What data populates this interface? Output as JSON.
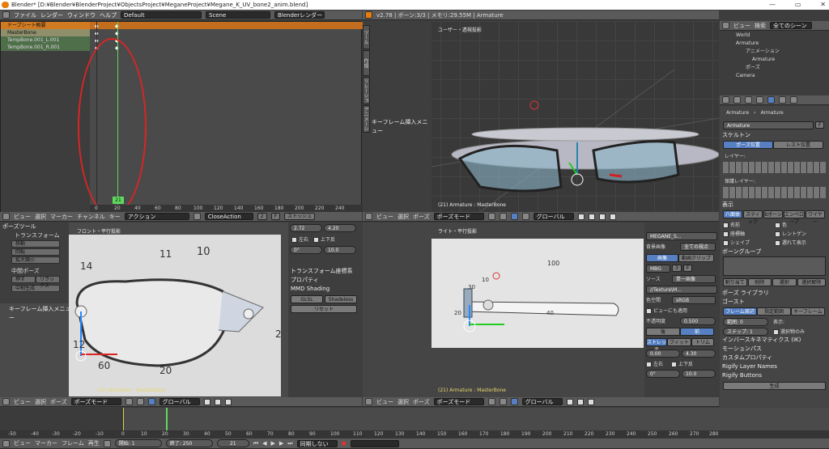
{
  "title_bar": {
    "text": "Blender* [D:¥Blender¥BlenderProject¥ObjectsProject¥MeganeProject¥Megane_K_UV_bone2_anim.blend]"
  },
  "top_menu": {
    "items": [
      "ファイル",
      "レンダー",
      "ウィンドウ",
      "ヘルプ"
    ],
    "layout": "Default",
    "scene": "Scene",
    "engine": "Blenderレンダー",
    "info": "v2.78 | ボーン:3/3 | メモリ:29.55M | Armature"
  },
  "dopesheet": {
    "channels": [
      "ドープシート概要",
      "MasterBone",
      "TempBone.001_L.001",
      "TempBone.001_R.001"
    ],
    "ruler": [
      "0",
      "20",
      "40",
      "60",
      "80",
      "100",
      "120",
      "140",
      "160",
      "180",
      "200",
      "220",
      "240"
    ],
    "current_frame": "21",
    "header": {
      "items": [
        "ビュー",
        "選択",
        "マーカー",
        "チャンネル",
        "キー"
      ],
      "mode": "アクション",
      "action": "CloseAction",
      "users": "2",
      "f": "F",
      "stash": "ストッシュ"
    }
  },
  "viewport_top": {
    "label": "ユーザー・透視投影",
    "status": "(21) Armature : MasterBone",
    "side_tabs": [
      "ツール",
      "作成",
      "リレーション",
      "アニメーション",
      "物理演算",
      "Grease Pencil"
    ],
    "panel_title": "キーフレーム挿入メニュー",
    "header": {
      "items": [
        "ビュー",
        "選択",
        "ポーズ"
      ],
      "mode": "ポーズモード",
      "orientation": "グローバル"
    }
  },
  "viewport_front": {
    "label": "フロント・平行投影",
    "status": "(21) Armature : MasterBone",
    "tool_title": "ポーズツール",
    "transform": "トランスフォーム",
    "tools": [
      "移動",
      "回転",
      "拡大縮小"
    ],
    "pose_title": "中間ポーズ",
    "pose_btns": [
      "押す",
      "リラックス"
    ],
    "breakdown": "中割生成",
    "key_panel": "キーフレーム挿入メニュー",
    "annotations": [
      "11",
      "10",
      "14",
      "12",
      "60",
      "20",
      "2"
    ],
    "header": {
      "items": [
        "ビュー",
        "選択",
        "ポーズ"
      ],
      "mode": "ポーズモード",
      "orientation": "グローバル"
    }
  },
  "front_props": {
    "vals": [
      "2.72",
      "4.20"
    ],
    "left_right": "左右",
    "up_down": "上下反",
    "v_deg": "0°",
    "v_ten": "10.0",
    "sections": [
      "トランスフォーム座標系",
      "プロパティ",
      "MMD Shading"
    ],
    "glsl": "GLSL",
    "shadeless": "Shadeless",
    "reset": "リセット"
  },
  "viewport_right": {
    "label": "ライト・平行投影",
    "status": "(21) Armature : MasterBone",
    "annotations": [
      "100",
      "10",
      "30",
      "20",
      "40"
    ],
    "header": {
      "items": [
        "ビュー",
        "選択",
        "ポーズ"
      ],
      "mode": "ポーズモード",
      "orientation": "グローバル"
    }
  },
  "image_panel": {
    "name": "MEGANE_S...",
    "source_label": "背景画像",
    "show_all": "全ての視点",
    "image": "画像",
    "movieclip": "動画クリップ",
    "img_name": "MBG",
    "users": "3",
    "f": "F",
    "source": "ソース",
    "single": "単一画像",
    "path": "//Texture\\M...",
    "colorspace_label": "色空間",
    "colorspace": "sRGB",
    "view_as_render": "ビューにも適用",
    "opacity_label": "不透明度",
    "opacity": "0.500",
    "back": "後",
    "front": "前",
    "stretch": "ストレッチ",
    "fit": "フィット",
    "crop": "トリム",
    "x": "0.00",
    "y": "4.30",
    "flip_x": "左右",
    "flip_y": "上下反",
    "rot": "0°",
    "size": "10.0"
  },
  "outliner": {
    "tabs": [
      "ビュー",
      "検索"
    ],
    "filter": "全てのシーン",
    "items": [
      "World",
      "Armature",
      "アニメーション",
      "Armature",
      "ポーズ",
      "Camera"
    ]
  },
  "properties": {
    "breadcrumb": [
      "Armature",
      "Armature"
    ],
    "name": "Armature",
    "f": "F",
    "skeleton": "スケルトン",
    "pose_position": "ポーズ位置",
    "rest_position": "レスト位置",
    "layers": "レイヤー:",
    "protected_layers": "保護レイヤー:",
    "display": "表示",
    "display_types": [
      "八面体",
      "スティック",
      "Bボーン",
      "エンベロープ",
      "ワイヤー"
    ],
    "checks": [
      "名前",
      "色",
      "座標軸",
      "レントゲン",
      "シェイプ",
      "遅れて表示"
    ],
    "bone_groups": "ボーングループ",
    "assign": "割り当て",
    "remove": "削除",
    "select": "選択",
    "deselect": "選択解除",
    "sections": [
      "ポーズ ライブラリ",
      "ゴースト"
    ],
    "ghost_tabs": [
      "フレーム周辺",
      "指定範囲",
      "キーフレーム"
    ],
    "range_label": "範囲:",
    "range": "0",
    "step_label": "ステップ:",
    "step": "1",
    "display_label": "表示:",
    "selected_only": "選択物のみ",
    "more": [
      "インバースキネマティクス (IK)",
      "モーションパス",
      "カスタムプロパティ",
      "Rigify Layer Names",
      "Rigify Buttons"
    ],
    "generate": "生成"
  },
  "timeline": {
    "ruler": [
      "-50",
      "-40",
      "-30",
      "-20",
      "-10",
      "0",
      "10",
      "20",
      "30",
      "40",
      "50",
      "60",
      "70",
      "80",
      "90",
      "100",
      "110",
      "120",
      "130",
      "140",
      "150",
      "160",
      "170",
      "180",
      "190",
      "200",
      "210",
      "220",
      "230",
      "240",
      "250",
      "260",
      "270",
      "280"
    ],
    "header": {
      "items": [
        "ビュー",
        "マーカー",
        "フレーム",
        "再生"
      ],
      "start_label": "開始:",
      "start": "1",
      "end_label": "終了:",
      "end": "250",
      "frame": "21",
      "sync": "同期しない"
    }
  }
}
